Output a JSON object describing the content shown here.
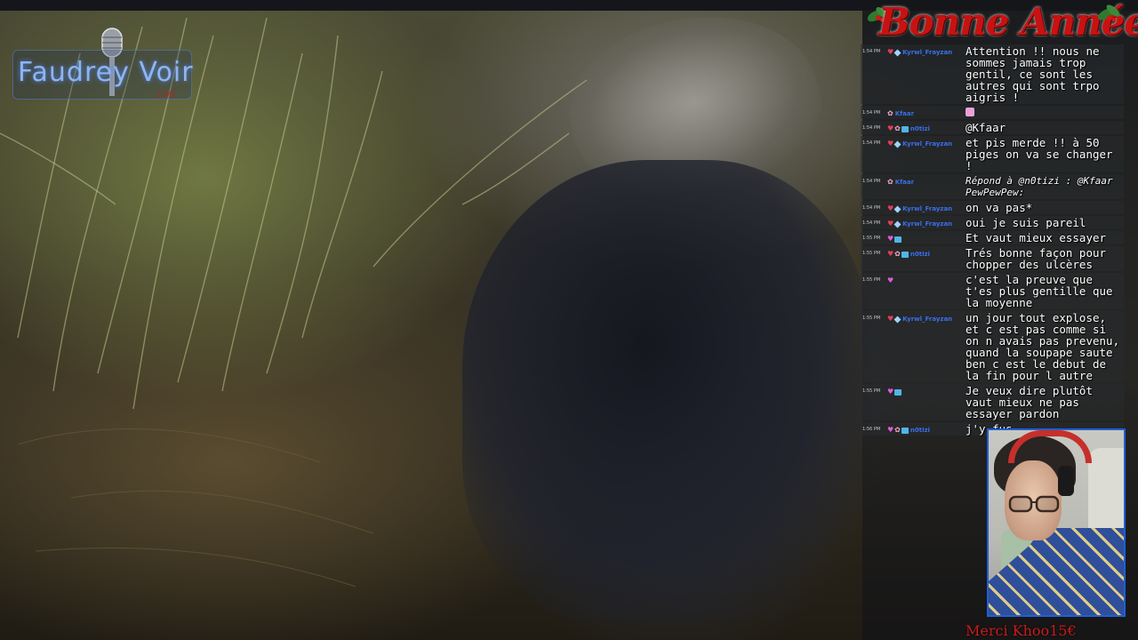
{
  "logo": {
    "title": "Faudrey Voir",
    "tag": "LIVE"
  },
  "banner": {
    "text": "Bonne Année"
  },
  "chat": {
    "messages": [
      {
        "time": "1:54 PM",
        "user": "Kyrwl_Frayzan",
        "badges": [
          "heart",
          "gem"
        ],
        "text": "Attention !! nous ne sommes jamais trop gentil, ce sont les autres qui sont trpo aigris !",
        "italic": false
      },
      {
        "time": "1:54 PM",
        "user": "Kfaar",
        "badges": [
          "cat"
        ],
        "text": "",
        "emoji": true,
        "italic": false
      },
      {
        "time": "1:54 PM",
        "user": "n0tizi",
        "badges": [
          "heart",
          "cat",
          "sub"
        ],
        "text": "@Kfaar",
        "italic": false
      },
      {
        "time": "1:54 PM",
        "user": "Kyrwl_Frayzan",
        "badges": [
          "heart",
          "gem"
        ],
        "text": "et pis merde !! à 50 piges on va se changer !",
        "italic": false
      },
      {
        "time": "1:54 PM",
        "user": "Kfaar",
        "badges": [
          "cat"
        ],
        "text": "Répond à @n0tizi : @Kfaar PewPewPew:",
        "italic": true
      },
      {
        "time": "1:54 PM",
        "user": "Kyrwl_Frayzan",
        "badges": [
          "heart",
          "gem"
        ],
        "text": "on va pas*",
        "italic": false
      },
      {
        "time": "1:54 PM",
        "user": "Kyrwl_Frayzan",
        "badges": [
          "heart",
          "gem"
        ],
        "text": "oui je suis pareil",
        "italic": false
      },
      {
        "time": "1:55 PM",
        "user": "",
        "badges": [
          "pink",
          "sub"
        ],
        "text": "Et vaut mieux essayer",
        "italic": false
      },
      {
        "time": "1:55 PM",
        "user": "n0tizi",
        "badges": [
          "heart",
          "cat",
          "sub"
        ],
        "text": "Trés bonne façon pour chopper des ulcères",
        "italic": false
      },
      {
        "time": "1:55 PM",
        "user": "",
        "badges": [
          "pink"
        ],
        "text": "c'est la preuve que t'es plus gentille que la moyenne",
        "italic": false
      },
      {
        "time": "1:55 PM",
        "user": "Kyrwl_Frayzan",
        "badges": [
          "heart",
          "gem"
        ],
        "text": "un jour tout explose, et c est pas comme si on n avais pas prevenu, quand la soupape saute ben c est le debut de la fin pour l autre",
        "italic": false
      },
      {
        "time": "1:55 PM",
        "user": "",
        "badges": [
          "pink",
          "sub"
        ],
        "text": "Je veux dire plutôt vaut mieux ne pas essayer pardon",
        "italic": false
      },
      {
        "time": "1:56 PM",
        "user": "n0tizi",
        "badges": [
          "pink",
          "cat",
          "sub"
        ],
        "text": "j'y fus",
        "italic": false
      }
    ]
  },
  "ticker": {
    "line1": "",
    "line2": "Merci Khoo15€"
  },
  "colors": {
    "accent_blue": "#1f5fd8",
    "banner_red": "#c81212",
    "username_blue": "#3b6ee8"
  }
}
